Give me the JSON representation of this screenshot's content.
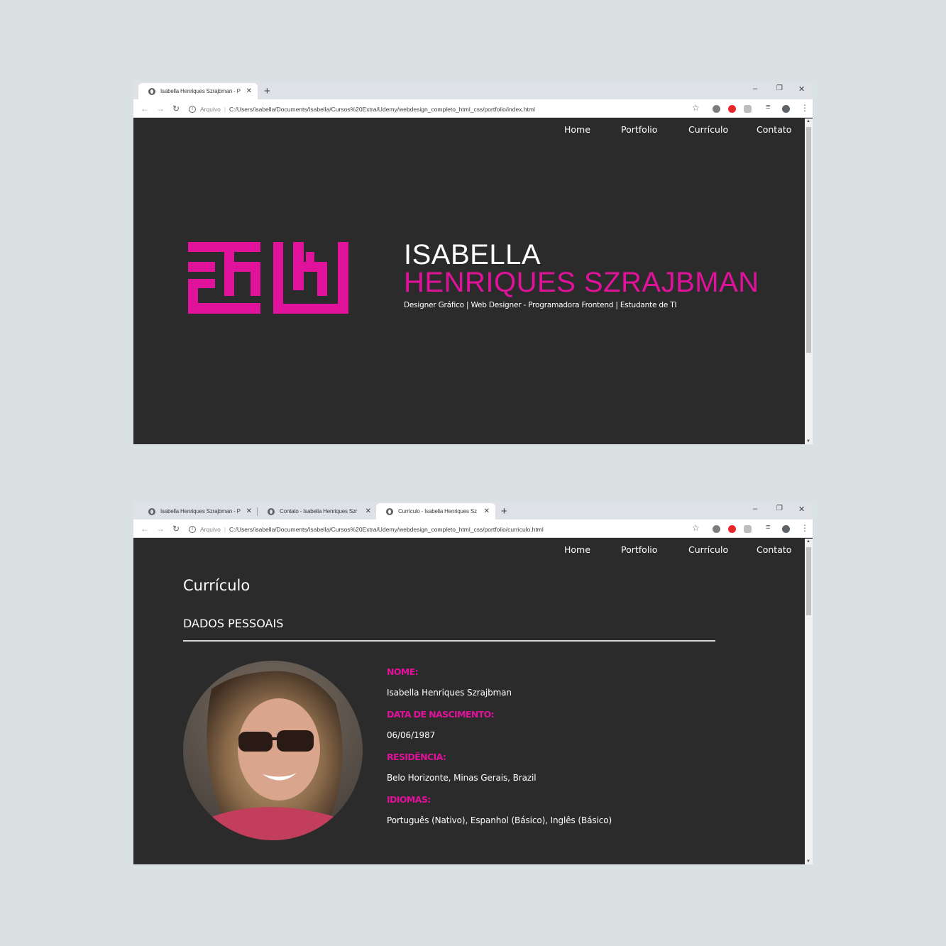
{
  "colors": {
    "background": "#dae1e3",
    "page_bg": "#2b2b2b",
    "accent": "#e0119a",
    "text": "#ffffff"
  },
  "window1": {
    "tabs": [
      {
        "label": "Isabella Henriques Szrajbman - P",
        "active": true,
        "icon": "globe-icon"
      }
    ],
    "address": {
      "scheme": "Arquivo",
      "url": "C:/Users/isabella/Documents/Isabella/Cursos%20Extra/Udemy/webdesign_completo_html_css/portfolio/index.html"
    },
    "nav": [
      "Home",
      "Portfolio",
      "Currículo",
      "Contato"
    ],
    "hero": {
      "first_name": "ISABELLA",
      "last_name": "HENRIQUES SZRAJBMAN",
      "subtitle": "Designer Gráfico | Web Designer - Programadora Frontend | Estudante de TI"
    }
  },
  "window2": {
    "tabs": [
      {
        "label": "Isabella Henriques Szrajbman - P",
        "active": false,
        "icon": "globe-icon"
      },
      {
        "label": "Contato - Isabella Henriques Szr",
        "active": false,
        "icon": "globe-icon"
      },
      {
        "label": "Currículo - Isabella Henriques Sz",
        "active": true,
        "icon": "globe-icon"
      }
    ],
    "address": {
      "scheme": "Arquivo",
      "url": "C:/Users/isabella/Documents/Isabella/Cursos%20Extra/Udemy/webdesign_completo_html_css/portfolio/curriculo.html"
    },
    "nav": [
      "Home",
      "Portfolio",
      "Currículo",
      "Contato"
    ],
    "page_title": "Currículo",
    "section_title": "DADOS PESSOAIS",
    "fields": [
      {
        "label": "NOME:",
        "value": "Isabella Henriques Szrajbman"
      },
      {
        "label": "DATA DE NASCIMENTO:",
        "value": "06/06/1987"
      },
      {
        "label": "RESIDÊNCIA:",
        "value": "Belo Horizonte, Minas Gerais, Brazil"
      },
      {
        "label": "IDIOMAS:",
        "value": "Português (Nativo), Espanhol (Básico), Inglês (Básico)"
      }
    ]
  }
}
